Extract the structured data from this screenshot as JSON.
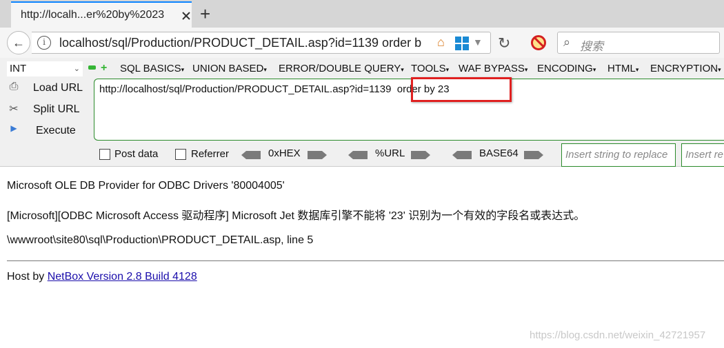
{
  "tab": {
    "title": "http://localh...er%20by%2023",
    "close_icon": "close-icon",
    "new_tab_symbol": "+"
  },
  "nav": {
    "url": "localhost/sql/Production/PRODUCT_DETAIL.asp?id=1139  order b",
    "search_placeholder": "搜索",
    "back_symbol": "←",
    "info_symbol": "i",
    "reload_symbol": "↻",
    "home_symbol": "⌂",
    "search_symbol": "⌕",
    "dropdown_symbol": "▼"
  },
  "hackbar": {
    "type_select": "INT",
    "chevron": "⌄",
    "plus_symbol": "+",
    "menus": [
      "SQL BASICS",
      "UNION BASED",
      "ERROR/DOUBLE QUERY",
      "TOOLS",
      "WAF BYPASS",
      "ENCODING",
      "HTML",
      "ENCRYPTION"
    ],
    "load_url": "Load URL",
    "split_url": "Split URL",
    "execute": "Execute",
    "load_symbol": "⎙",
    "split_symbol": "✂",
    "execute_symbol": "▶",
    "url_value": "http://localhost/sql/Production/PRODUCT_DETAIL.asp?id=1139  order by 23",
    "post_data": "Post data",
    "referrer": "Referrer",
    "hex": "0xHEX",
    "url_enc": "%URL",
    "base64": "BASE64",
    "replace_placeholder": "Insert string to replace",
    "replace_with_placeholder": "Insert re"
  },
  "page": {
    "line1": "Microsoft OLE DB Provider for ODBC Drivers '80004005'",
    "line2": "[Microsoft][ODBC Microsoft Access 驱动程序] Microsoft Jet 数据库引擎不能将 '23' 识别为一个有效的字段名或表达式。",
    "line3": "\\wwwroot\\site80\\sql\\Production\\PRODUCT_DETAIL.asp, line 5",
    "host_prefix": "Host by ",
    "host_link": "NetBox Version 2.8 Build 4128"
  },
  "watermark": "https://blog.csdn.net/weixin_42721957",
  "colors": {
    "accent_tab": "#0a84ff",
    "highlight": "#e02020",
    "hackbar_border": "#2a8a2a",
    "link": "#1a0dab"
  }
}
